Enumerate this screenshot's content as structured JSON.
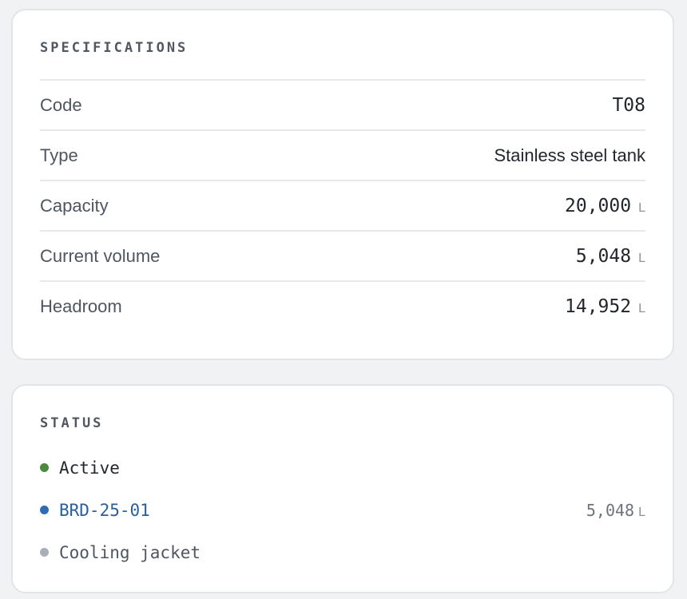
{
  "specifications": {
    "title": "SPECIFICATIONS",
    "rows": [
      {
        "label": "Code",
        "value": "T08",
        "unit": ""
      },
      {
        "label": "Type",
        "value": "Stainless steel tank",
        "unit": ""
      },
      {
        "label": "Capacity",
        "value": "20,000",
        "unit": "L"
      },
      {
        "label": "Current volume",
        "value": "5,048",
        "unit": "L"
      },
      {
        "label": "Headroom",
        "value": "14,952",
        "unit": "L"
      }
    ]
  },
  "status": {
    "title": "STATUS",
    "items": [
      {
        "label": "Active",
        "dot_color": "#4a8a3c",
        "text_color": "#22262d",
        "value": "",
        "unit": ""
      },
      {
        "label": "BRD-25-01",
        "dot_color": "#2f6db3",
        "text_color": "#2a5f9e",
        "value": "5,048",
        "unit": "L"
      },
      {
        "label": "Cooling jacket",
        "dot_color": "#a9aeb7",
        "text_color": "#4d5661",
        "value": "",
        "unit": ""
      }
    ]
  }
}
